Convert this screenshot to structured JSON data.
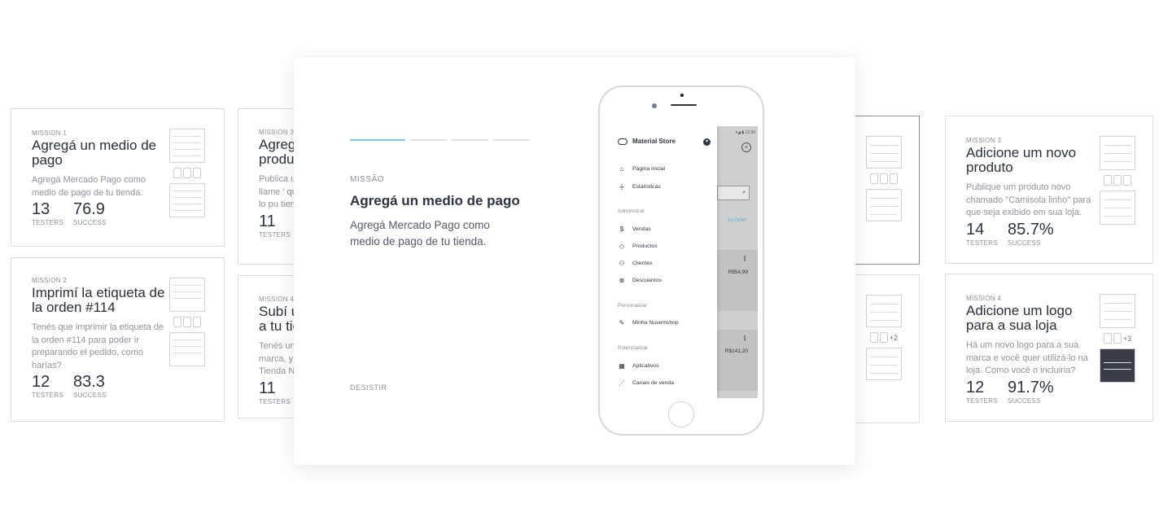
{
  "cards": [
    {
      "label": "MISSION 1",
      "title": "Agregá un medio de pago",
      "desc": "Agregá Mercado Pago como medio de pago de tu tienda.",
      "testers": "13",
      "success": "76.9",
      "testers_label": "TESTERS",
      "success_label": "SUCCESS"
    },
    {
      "label": "MISSION 2",
      "title": "Imprimí la etiqueta de la orden #114",
      "desc": "Tenés que imprimir la etiqueta de la orden #114 para poder ir preparando el pedido, como harías?",
      "testers": "12",
      "success": "83.3",
      "testers_label": "TESTERS",
      "success_label": "SUCCESS"
    },
    {
      "label": "MISSION 3",
      "title": "Agreg produ",
      "desc": "Publica u se llame ' que lo pu tienda.",
      "testers": "11",
      "testers_label": "TESTERS"
    },
    {
      "label": "MISSION 4",
      "title": "Subí u a tu tie",
      "desc": "Tenés un marca, y Tienda N",
      "testers": "11",
      "testers_label": "TESTERS"
    },
    {
      "label": "MISSION 3",
      "title": "Adicione um novo produto",
      "desc": "Publique um produto novo chamado \"Camisola linho\" para que seja exibido em sua loja.",
      "testers": "14",
      "success": "85.7%",
      "testers_label": "TESTERS",
      "success_label": "SUCCESS"
    },
    {
      "label": "MISSION 4",
      "title": "Adicione um logo para a sua loja",
      "desc": "Há um novo logo para a sua marca e você quer utilizá-lo na loja. Como você o incluiria?",
      "testers": "12",
      "success": "91.7%",
      "testers_label": "TESTERS",
      "success_label": "SUCCESS"
    }
  ],
  "thumbs": {
    "plus2": "+2",
    "plus3": "+3"
  },
  "modal": {
    "label": "MISSÃO",
    "title": "Agregá un medio de pago",
    "desc": "Agregá Mercado Pago como medio de pago de tu tienda.",
    "quit": "DESISTIR",
    "progress": {
      "active": 1,
      "total": 4
    }
  },
  "phone": {
    "status": "▾◢ ▮ 12:30",
    "store": "Material Store",
    "menu": [
      {
        "icon": "home-icon",
        "glyph": "⌂",
        "label": "Página inicial"
      },
      {
        "icon": "chart-icon",
        "glyph": "⏚",
        "label": "Estatísticas"
      }
    ],
    "sections": [
      "Administrar",
      "Personalizar",
      "Potencializar"
    ],
    "admin": [
      {
        "icon": "dollar-icon",
        "glyph": "$",
        "label": "Vendas"
      },
      {
        "icon": "tag-icon",
        "glyph": "◇",
        "label": "Productos"
      },
      {
        "icon": "users-icon",
        "glyph": "⚇",
        "label": "Clientes"
      },
      {
        "icon": "discount-icon",
        "glyph": "⊗",
        "label": "Descuentos"
      }
    ],
    "custom": [
      {
        "icon": "brush-icon",
        "glyph": "✎",
        "label": "Minha Nuvemshop"
      }
    ],
    "boost": [
      {
        "icon": "apps-icon",
        "glyph": "▦",
        "label": "Aplicativos"
      },
      {
        "icon": "channels-icon",
        "glyph": "⋰",
        "label": "Canais de venda"
      }
    ],
    "filter": "FILTRAR",
    "price1": "R$54,99",
    "price2": "R$141,20"
  }
}
